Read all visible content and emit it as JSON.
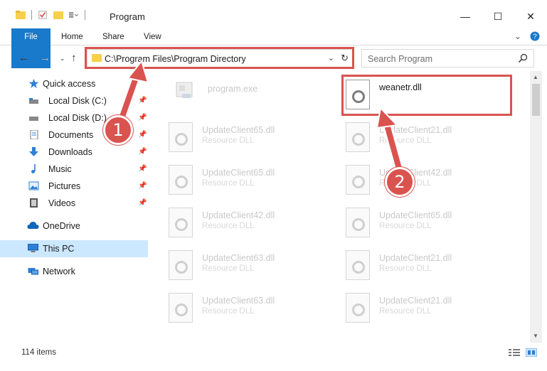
{
  "window": {
    "title": "Program",
    "minimize": "—",
    "maximize": "☐",
    "close": "✕"
  },
  "ribbon": {
    "tabs": [
      "File",
      "Home",
      "Share",
      "View"
    ],
    "help": "?"
  },
  "address": {
    "path": "C:\\Program Files\\Program Directory",
    "dropdown": "⌄",
    "refresh": "↻"
  },
  "search": {
    "placeholder": "Search Program"
  },
  "nav": {
    "items": [
      {
        "label": "Quick access",
        "icon": "star-icon"
      },
      {
        "label": "Local Disk (C:)",
        "icon": "drive-icon",
        "pinned": true
      },
      {
        "label": "Local Disk (D:)",
        "icon": "drive-icon",
        "pinned": true
      },
      {
        "label": "Documents",
        "icon": "documents-icon",
        "pinned": true
      },
      {
        "label": "Downloads",
        "icon": "download-icon",
        "pinned": true
      },
      {
        "label": "Music",
        "icon": "music-icon",
        "pinned": true
      },
      {
        "label": "Pictures",
        "icon": "pictures-icon",
        "pinned": true
      },
      {
        "label": "Videos",
        "icon": "videos-icon",
        "pinned": true
      },
      {
        "label": "OneDrive",
        "icon": "cloud-icon"
      },
      {
        "label": "This PC",
        "icon": "computer-icon",
        "selected": true
      },
      {
        "label": "Network",
        "icon": "network-icon"
      }
    ]
  },
  "files": [
    {
      "name": "program.exe",
      "type": ""
    },
    {
      "name": "weanetr.dll",
      "type": ""
    },
    {
      "name": "UpdateClient65.dll",
      "type": "Resource DLL"
    },
    {
      "name": "UpdateClient21.dll",
      "type": "Resource DLL"
    },
    {
      "name": "UpdateClient65.dll",
      "type": "Resource DLL"
    },
    {
      "name": "UpdateClient42.dll",
      "type": "Resource DLL"
    },
    {
      "name": "UpdateClient42.dll",
      "type": "Resource DLL"
    },
    {
      "name": "UpdateClient65.dll",
      "type": "Resource DLL"
    },
    {
      "name": "UpdateClient63.dll",
      "type": "Resource DLL"
    },
    {
      "name": "UpdateClient21.dll",
      "type": "Resource DLL"
    },
    {
      "name": "UpdateClient63.dll",
      "type": "Resource DLL"
    },
    {
      "name": "UpdateClient21.dll",
      "type": "Resource DLL"
    }
  ],
  "status": {
    "items": "114 items"
  },
  "annotations": {
    "marker1": "1",
    "marker2": "2"
  },
  "colors": {
    "accent": "#1979ca",
    "highlight": "#d9534f",
    "selected": "#cce8ff"
  }
}
